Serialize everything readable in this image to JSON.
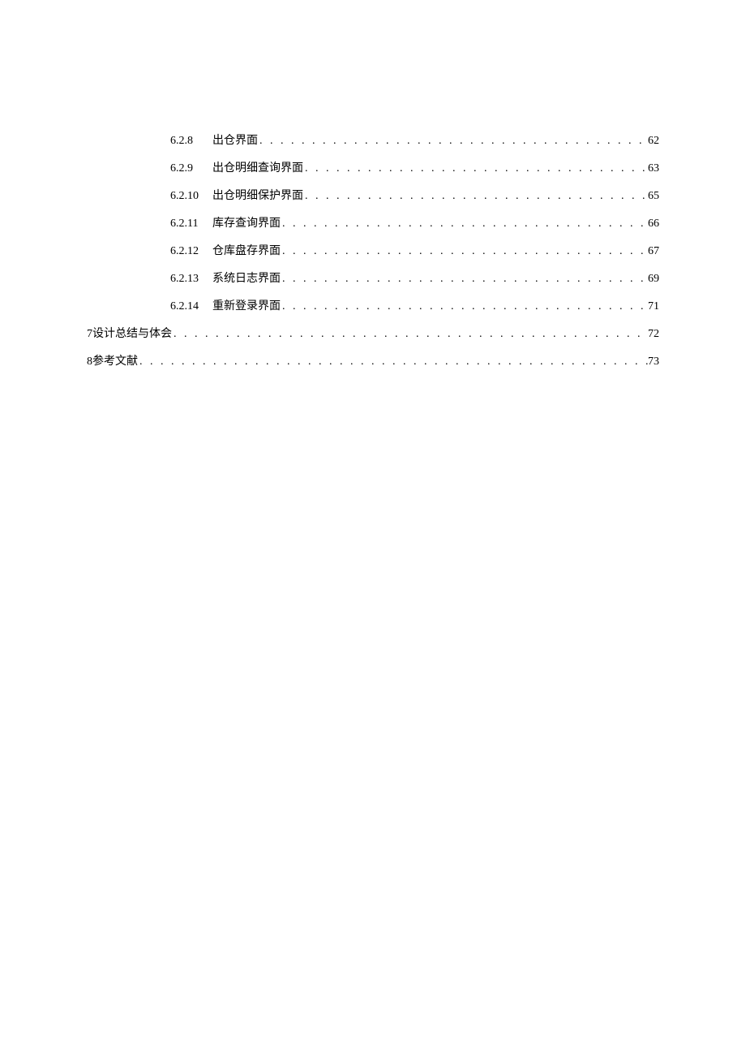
{
  "toc": {
    "entries": [
      {
        "level": 3,
        "number": "6.2.8",
        "title": "出仓界面",
        "page": "62"
      },
      {
        "level": 3,
        "number": "6.2.9",
        "title": "出仓明细查询界面",
        "page": "63"
      },
      {
        "level": 3,
        "number": "6.2.10",
        "title": "出仓明细保护界面",
        "page": "65"
      },
      {
        "level": 3,
        "number": "6.2.11",
        "title": "库存查询界面",
        "page": "66"
      },
      {
        "level": 3,
        "number": "6.2.12",
        "title": "仓库盘存界面",
        "page": "67"
      },
      {
        "level": 3,
        "number": "6.2.13",
        "title": "系统日志界面",
        "page": "69"
      },
      {
        "level": 3,
        "number": "6.2.14",
        "title": "重新登录界面",
        "page": "71"
      },
      {
        "level": 1,
        "number": "7",
        "title": " 设计总结与体会",
        "page": "72"
      },
      {
        "level": 1,
        "number": "8",
        "title": " 参考文献",
        "page": "73"
      }
    ]
  }
}
